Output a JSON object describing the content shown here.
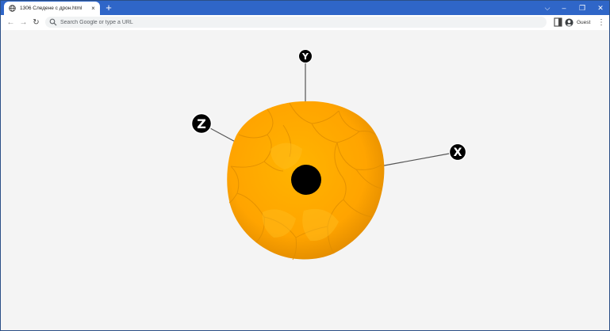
{
  "browser": {
    "tab": {
      "title": "1306 Следене с дрон.html",
      "close": "×"
    },
    "new_tab": "+",
    "window_controls": {
      "dropdown": "⌵",
      "minimize": "–",
      "restore": "❐",
      "close": "✕"
    },
    "nav": {
      "back": "←",
      "forward": "→",
      "reload": "↻"
    },
    "omnibox": {
      "placeholder": "Search Google or type a URL",
      "value": ""
    },
    "profile": {
      "label": "Guest"
    },
    "menu": "⋮"
  },
  "scene": {
    "axes": [
      {
        "name": "y-axis",
        "label": "Y"
      },
      {
        "name": "z-axis",
        "label": "Z"
      },
      {
        "name": "x-axis",
        "label": "X"
      }
    ],
    "colors": {
      "sphere": "#ffab00",
      "sphere_dark": "#e08800",
      "center": "#000000",
      "axis_line": "#555555",
      "axis_label_bg": "#000000",
      "axis_label_fg": "#ffffff"
    }
  }
}
